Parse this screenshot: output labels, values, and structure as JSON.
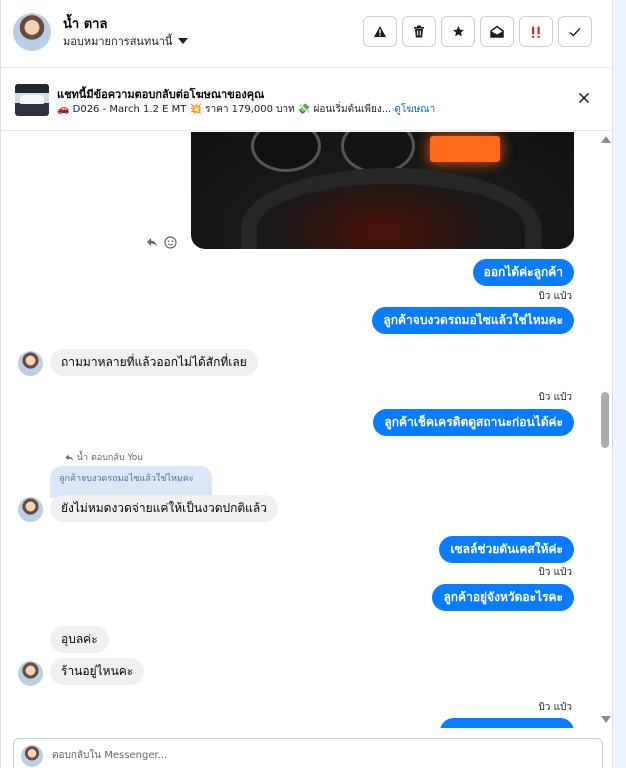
{
  "header": {
    "contact_name": "น้ำ ตาล",
    "assign_label": "มอบหมายการสนทนานี้",
    "actions": [
      {
        "name": "warning-icon"
      },
      {
        "name": "trash-icon"
      },
      {
        "name": "star-icon"
      },
      {
        "name": "mark-unread-icon"
      },
      {
        "name": "spam-icon",
        "color": "#e02020"
      },
      {
        "name": "checkmark-icon"
      }
    ]
  },
  "banner": {
    "title": "แชทนี้มีข้อความตอบกลับต่อโฆษณาของคุณ",
    "subtitle": "🚗 D026 - March 1.2 E MT 💥 ราคา 179,000 บาท 💸 ผ่อนเริ่มต้นเพียง...",
    "link": "ดูโฆษณา"
  },
  "messages": [
    {
      "dir": "out",
      "text": "ออกได้ค่ะลูกค้า"
    },
    {
      "seen": "บิว แป๋ว"
    },
    {
      "dir": "out",
      "text": "ลูกค้าจบงวดรถมอไซแล้วใช่ไหมคะ"
    },
    {
      "dir": "in",
      "text": "ถามมาหลายที่แล้วออกไม่ได้สักที่เลย"
    },
    {
      "seen": "บิว แป๋ว"
    },
    {
      "dir": "out",
      "text": "ลูกค้าเช็คเครดิตดูสถานะก่อนได้ค่ะ"
    },
    {
      "reply_note": "น้ำ ตอบกลับ You",
      "quoted": "ลูกค้าจบงวดรถมอไซแล้วใช่ไหมคะ"
    },
    {
      "dir": "in",
      "text": "ยังไม่หมดงวดจ่ายแค่ให้เป็นงวดปกติแล้ว"
    },
    {
      "dir": "out",
      "text": "เซลล์ช่วยดันเคสให้ค่ะ"
    },
    {
      "seen": "บิว แป๋ว"
    },
    {
      "dir": "out",
      "text": "ลูกค้าอยู่จังหวัดอะไรคะ"
    },
    {
      "dir": "in",
      "text": "อุบลค่ะ"
    },
    {
      "dir": "in",
      "text": "ร้านอยู่ไหนคะ"
    },
    {
      "seen": "บิว แป๋ว"
    }
  ],
  "composer": {
    "placeholder": "ตอบกลับใน Messenger..."
  },
  "colors": {
    "outgoing_bubble": "#0a7cff",
    "incoming_bubble": "#f0f0f0",
    "link": "#0a66c8",
    "quoted_bg": "#dbe7f9"
  }
}
